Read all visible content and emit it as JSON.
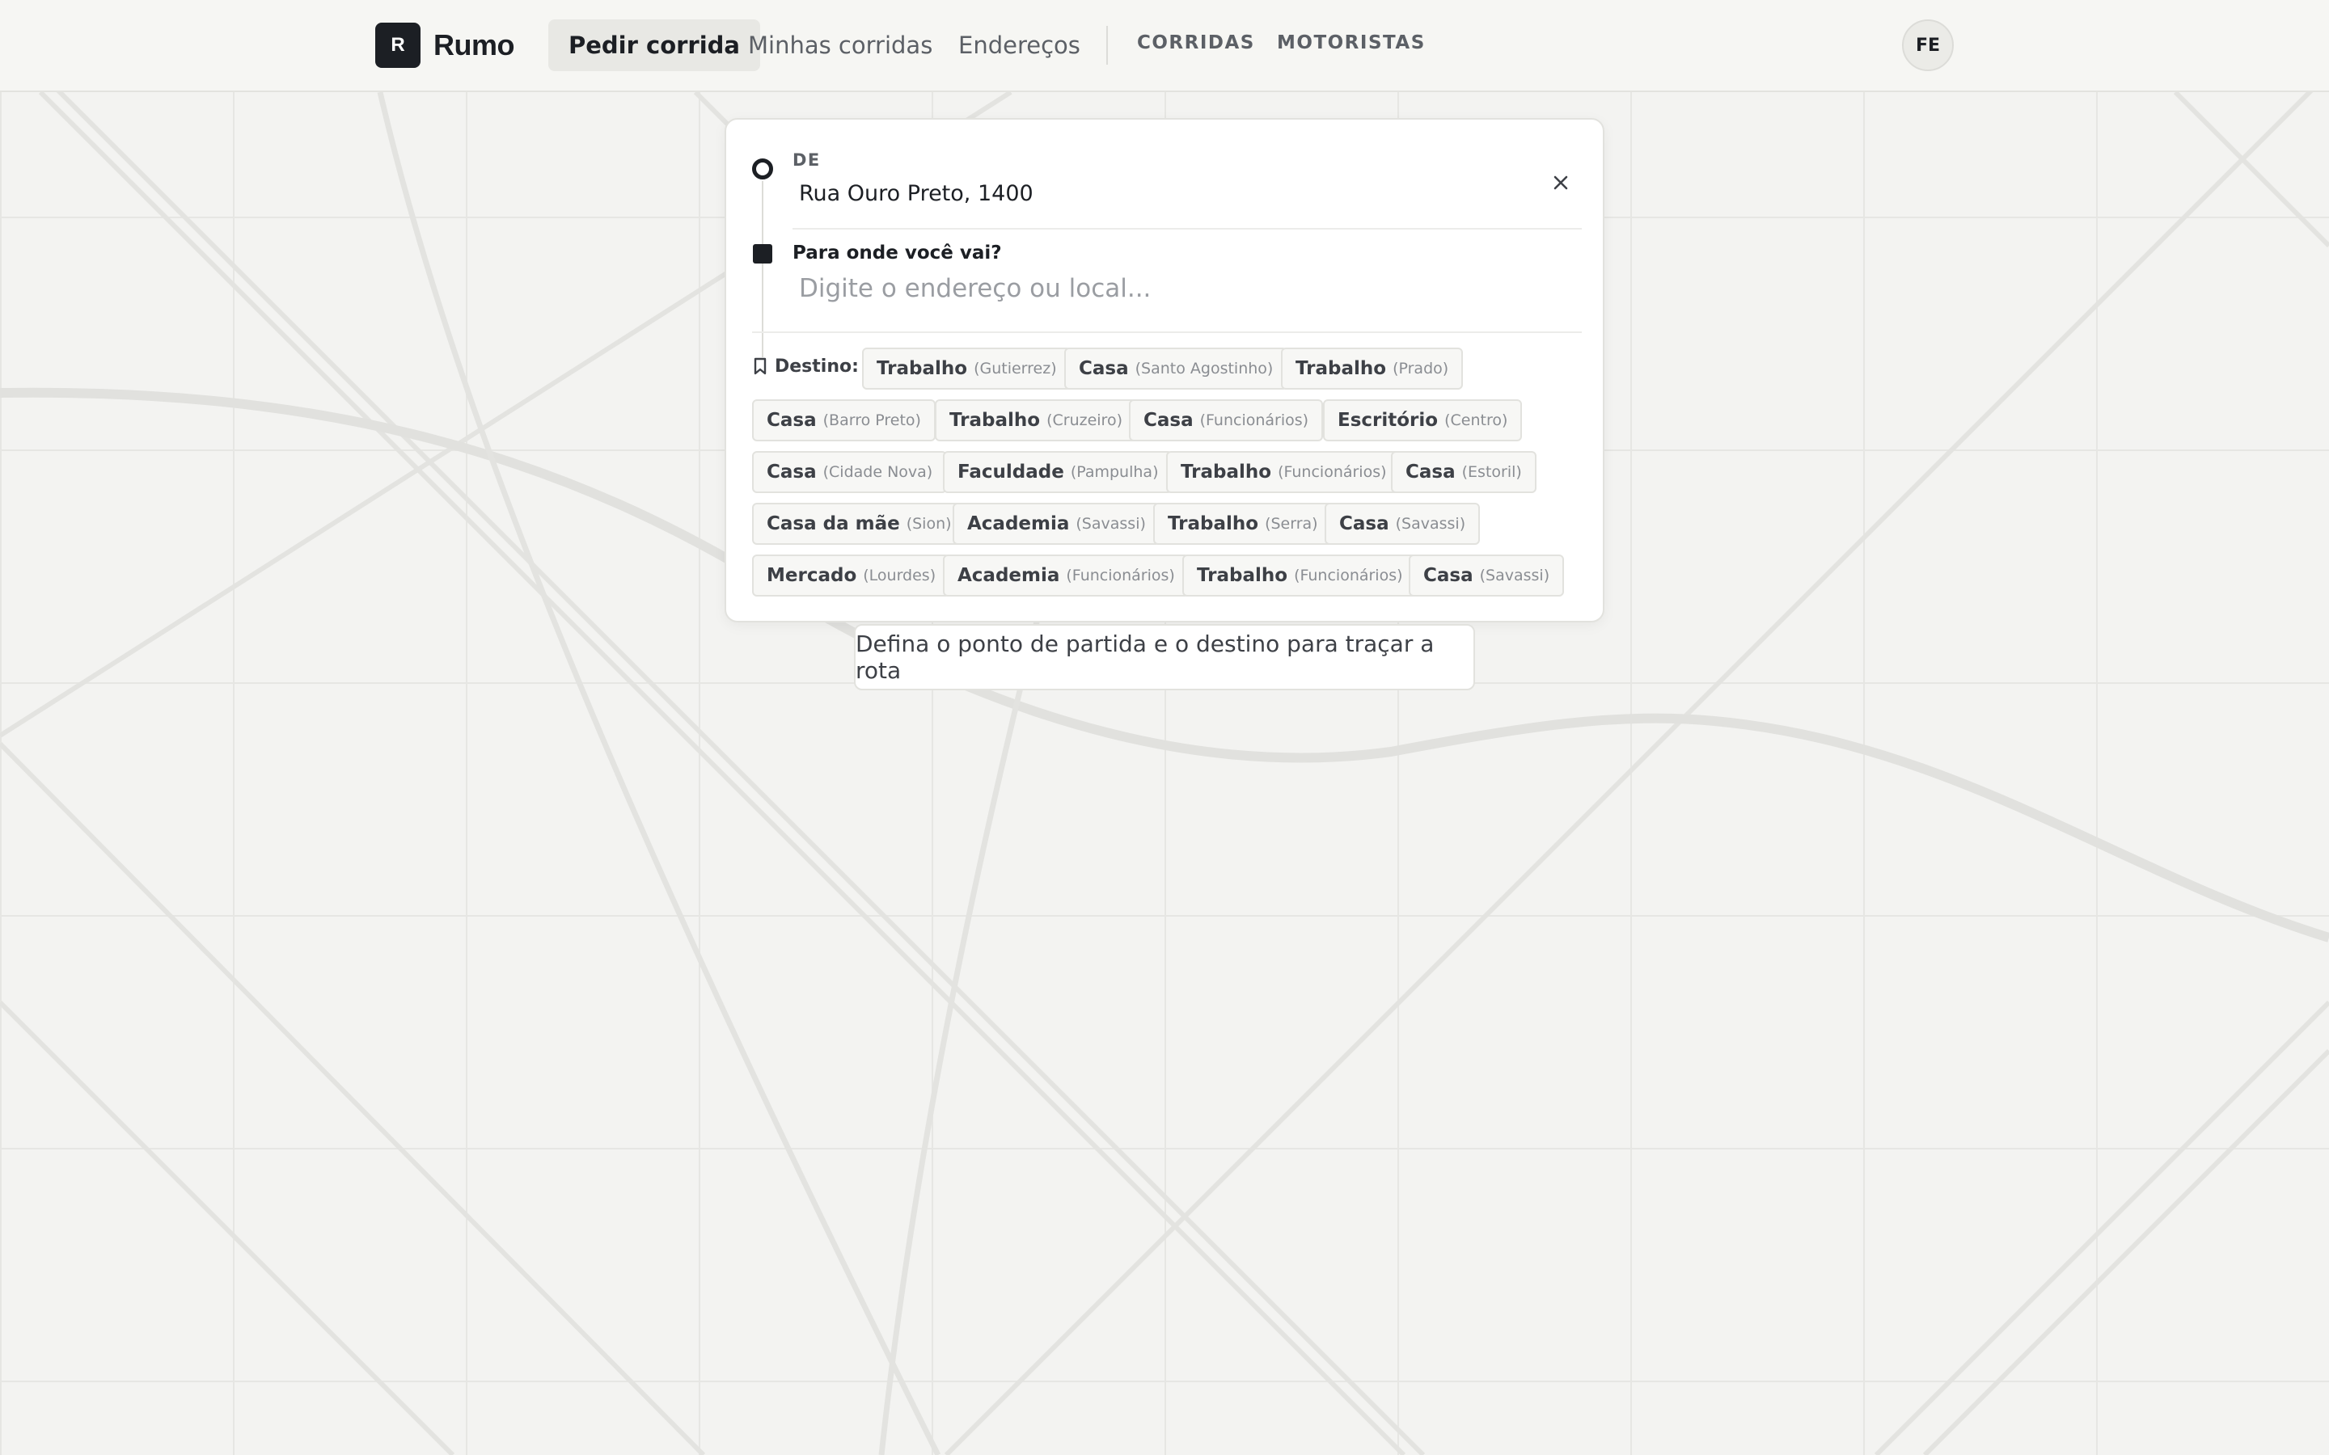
{
  "app": {
    "logo_letter": "R",
    "name": "Rumo"
  },
  "nav": {
    "items": [
      {
        "label": "Pedir corrida",
        "active": true
      },
      {
        "label": "Minhas corridas",
        "active": false
      },
      {
        "label": "Endereços",
        "active": false
      }
    ],
    "caps_items": [
      "CORRIDAS",
      "MOTORISTAS"
    ],
    "avatar_initials": "FE"
  },
  "route": {
    "from_label": "DE",
    "from_value": "Rua Ouro Preto, 1400",
    "to_label": "Para onde você vai?",
    "to_placeholder": "Digite o endereço ou local...",
    "to_value": "",
    "destinations_label": "Destino:",
    "destinations": [
      {
        "name": "Trabalho",
        "area": "(Gutierrez)"
      },
      {
        "name": "Casa",
        "area": "(Santo Agostinho)"
      },
      {
        "name": "Trabalho",
        "area": "(Prado)"
      },
      {
        "name": "Casa",
        "area": "(Barro Preto)"
      },
      {
        "name": "Trabalho",
        "area": "(Cruzeiro)"
      },
      {
        "name": "Casa",
        "area": "(Funcionários)"
      },
      {
        "name": "Escritório",
        "area": "(Centro)"
      },
      {
        "name": "Casa",
        "area": "(Cidade Nova)"
      },
      {
        "name": "Faculdade",
        "area": "(Pampulha)"
      },
      {
        "name": "Trabalho",
        "area": "(Funcionários)"
      },
      {
        "name": "Casa",
        "area": "(Estoril)"
      },
      {
        "name": "Casa da mãe",
        "area": "(Sion)"
      },
      {
        "name": "Academia",
        "area": "(Savassi)"
      },
      {
        "name": "Trabalho",
        "area": "(Serra)"
      },
      {
        "name": "Casa",
        "area": "(Savassi)"
      },
      {
        "name": "Mercado",
        "area": "(Lourdes)"
      },
      {
        "name": "Academia",
        "area": "(Funcionários)"
      },
      {
        "name": "Trabalho",
        "area": "(Funcionários)"
      },
      {
        "name": "Casa",
        "area": "(Savassi)"
      }
    ]
  },
  "hint": "Defina o ponto de partida e o destino para traçar a rota",
  "icons": {
    "close": "close-icon",
    "bookmark": "bookmark-icon"
  },
  "colors": {
    "accent": "#1c1f24",
    "map_background": "#f3f3f1",
    "map_roads": "#e2e2df"
  }
}
